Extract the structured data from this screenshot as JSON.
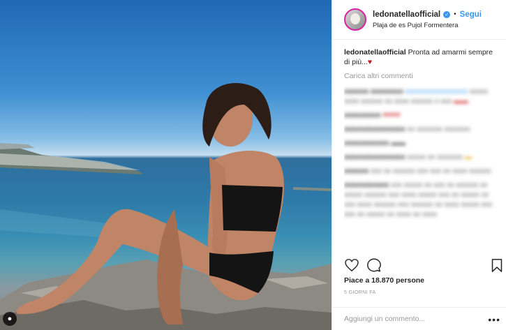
{
  "post": {
    "username": "ledonatellaofficial",
    "follow_label": "Segui",
    "location": "Plaja de es Pujol Formentera",
    "caption_text": "Pronta ad amarmi sempre di più...",
    "caption_emoji": "♥",
    "load_more": "Carica altri commenti",
    "likes": "Piace a 18.870 persone",
    "date": "5 GIORNI FA",
    "comment_placeholder": "Aggiungi un commento...",
    "more_label": "•••"
  },
  "icons": {
    "verified": "verified-badge-icon",
    "like": "heart-icon",
    "comment": "comment-bubble-icon",
    "save": "bookmark-icon",
    "tagged": "user-tag-icon"
  },
  "colors": {
    "link": "#3897f0",
    "text": "#262626",
    "muted": "#999999",
    "border": "#efefef"
  }
}
